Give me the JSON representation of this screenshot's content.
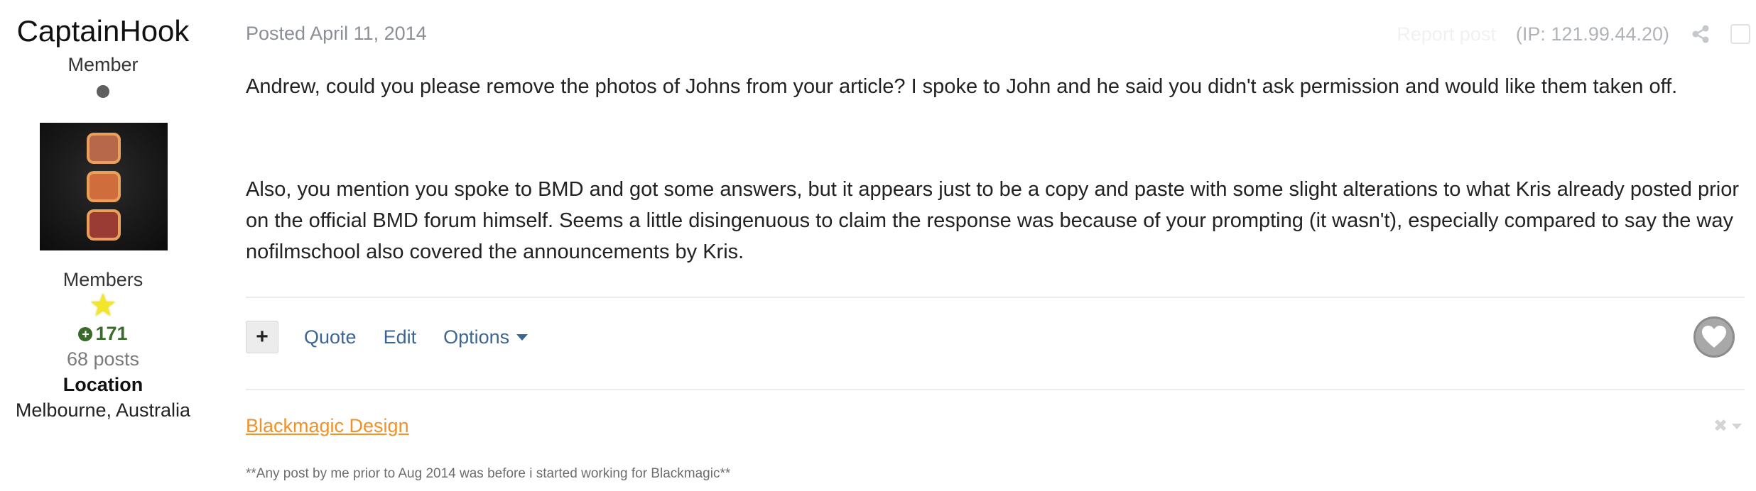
{
  "author": {
    "name": "CaptainHook",
    "title": "Member",
    "group": "Members",
    "reputation": "171",
    "posts": "68 posts",
    "location_label": "Location",
    "location_value": "Melbourne, Australia",
    "icons": {
      "online": "online-status-dot",
      "rank": "star-icon",
      "reputation": "plus-circle-icon"
    },
    "colors": {
      "reputation": "#3b6b2a",
      "star": "#f2e629"
    }
  },
  "post": {
    "date": "Posted April 11, 2014",
    "report_label": "Report post",
    "ip": "(IP: 121.99.44.20)",
    "paragraphs": [
      "Andrew, could you please remove the photos of Johns from your article? I spoke to John and he said you didn't ask permission and would like them taken off.",
      "Also, you mention you spoke to BMD and got some answers, but it appears just to be a copy and paste with some slight alterations to what Kris already posted prior on the official BMD forum himself. Seems a little disingenuous to claim the response was because of your prompting (it wasn't), especially compared to say the way nofilmschool also covered the announcements by Kris."
    ]
  },
  "actions": {
    "plus": "+",
    "quote": "Quote",
    "edit": "Edit",
    "options": "Options",
    "link_color": "#3d6594"
  },
  "signature": {
    "link": "Blackmagic Design",
    "note": "**Any post by me prior to Aug 2014 was before i started working for Blackmagic**",
    "close": "✖",
    "link_color": "#f0912a"
  }
}
